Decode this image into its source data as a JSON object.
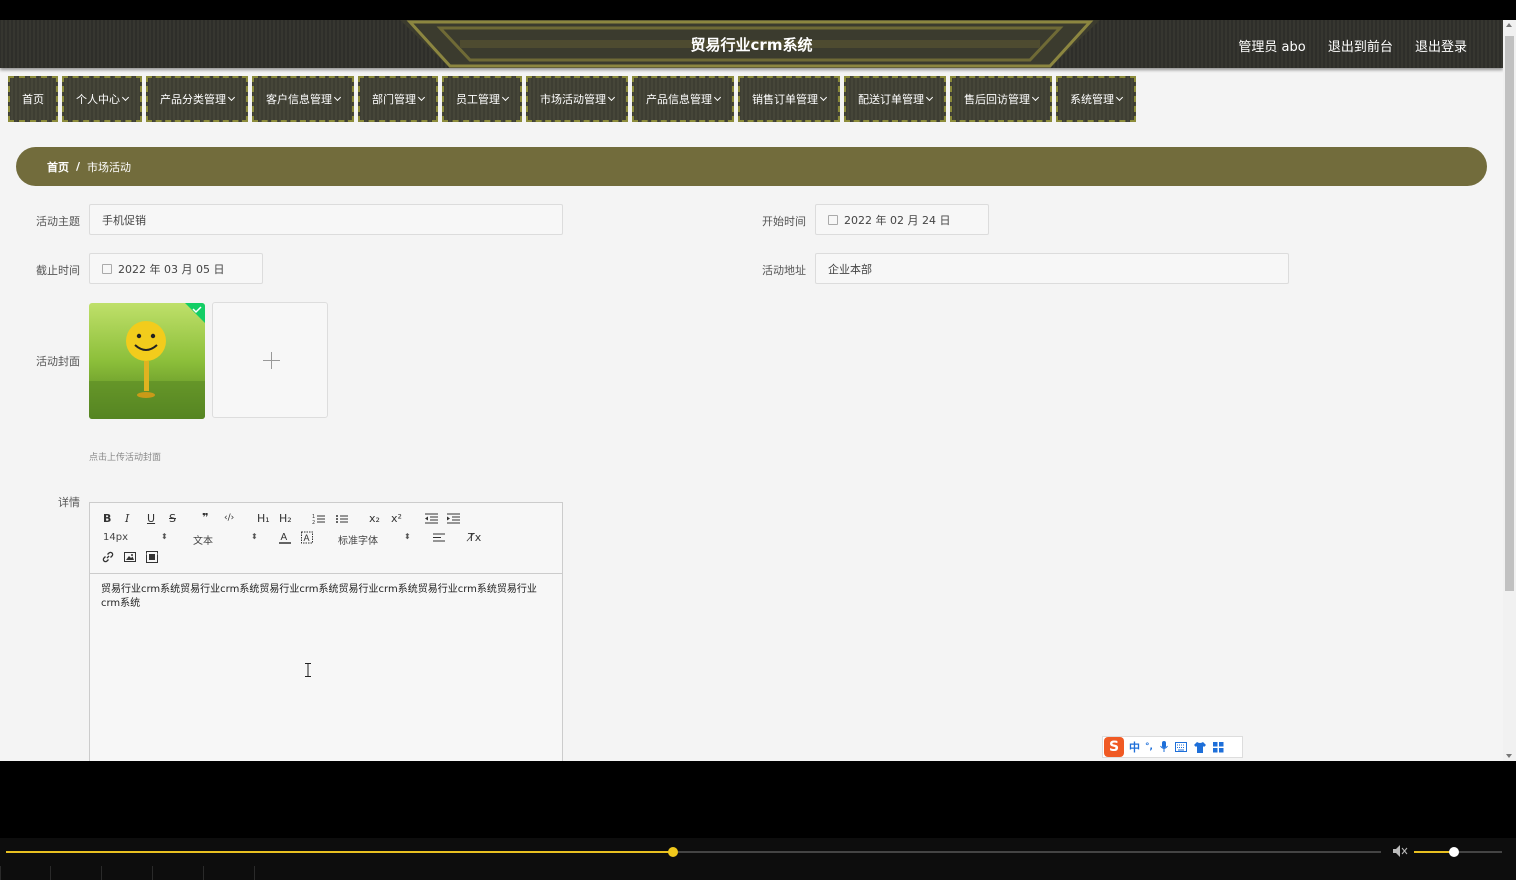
{
  "header": {
    "title": "贸易行业crm系统",
    "user": "管理员 abo",
    "back_to_front": "退出到前台",
    "logout": "退出登录"
  },
  "nav": [
    {
      "label": "首页",
      "dropdown": false
    },
    {
      "label": "个人中心",
      "dropdown": true
    },
    {
      "label": "产品分类管理",
      "dropdown": true
    },
    {
      "label": "客户信息管理",
      "dropdown": true
    },
    {
      "label": "部门管理",
      "dropdown": true
    },
    {
      "label": "员工管理",
      "dropdown": true
    },
    {
      "label": "市场活动管理",
      "dropdown": true
    },
    {
      "label": "产品信息管理",
      "dropdown": true
    },
    {
      "label": "销售订单管理",
      "dropdown": true
    },
    {
      "label": "配送订单管理",
      "dropdown": true
    },
    {
      "label": "售后回访管理",
      "dropdown": true
    },
    {
      "label": "系统管理",
      "dropdown": true
    }
  ],
  "breadcrumb": {
    "home": "首页",
    "separator": "/",
    "current": "市场活动"
  },
  "form": {
    "topic_label": "活动主题",
    "topic_value": "手机促销",
    "start_label": "开始时间",
    "start_value": "2022 年 02 月 24 日",
    "end_label": "截止时间",
    "end_value": "2022 年 03 月 05 日",
    "address_label": "活动地址",
    "address_value": "企业本部",
    "cover_label": "活动封面",
    "cover_hint": "点击上传活动封面",
    "detail_label": "详情"
  },
  "editor": {
    "toolbar": {
      "bold": "B",
      "italic": "I",
      "underline": "U",
      "strike": "S",
      "quote": "❞",
      "code": "‹/›",
      "h1": "H₁",
      "h2": "H₂",
      "sub": "x₂",
      "sup": "x²",
      "size": "14px",
      "format": "文本",
      "font": "标准字体",
      "clean": "T̸x"
    },
    "content": "贸易行业crm系统贸易行业crm系统贸易行业crm系统贸易行业crm系统贸易行业crm系统贸易行业crm系统"
  },
  "ime": {
    "logo": "S",
    "mode": "中",
    "punct": "°,"
  },
  "player": {
    "progress": 0.485,
    "volume": 0.45
  },
  "colors": {
    "accent": "#726c3c",
    "nav_border": "#8c8c3a",
    "progress": "#e8c020"
  }
}
